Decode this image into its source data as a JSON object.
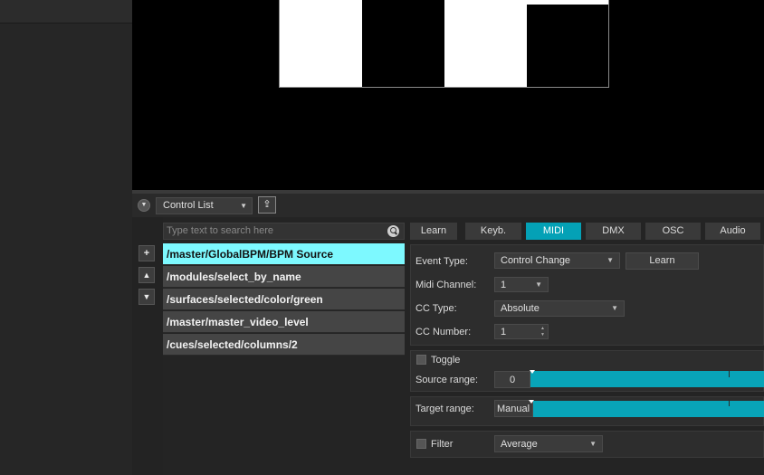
{
  "control_strip": {
    "list_dropdown": "Control List",
    "collapse_glyph": "▼",
    "export_glyph": "⇪"
  },
  "tools": {
    "add": "+",
    "up": "▲",
    "down": "▼"
  },
  "search": {
    "placeholder": "Type text to search here"
  },
  "control_list": [
    {
      "label": "/master/GlobalBPM/BPM Source",
      "selected": true
    },
    {
      "label": "/modules/select_by_name",
      "selected": false
    },
    {
      "label": "/surfaces/selected/color/green",
      "selected": false
    },
    {
      "label": "/master/master_video_level",
      "selected": false
    },
    {
      "label": "/cues/selected/columns/2",
      "selected": false
    }
  ],
  "tabs": [
    {
      "label": "Learn",
      "active": false
    },
    {
      "label": "Keyb.",
      "active": false
    },
    {
      "label": "MIDI",
      "active": true
    },
    {
      "label": "DMX",
      "active": false
    },
    {
      "label": "OSC",
      "active": false
    },
    {
      "label": "Audio",
      "active": false
    }
  ],
  "midi": {
    "event_type_label": "Event Type:",
    "event_type_value": "Control Change",
    "learn_button": "Learn",
    "channel_label": "Midi Channel:",
    "channel_value": "1",
    "cc_type_label": "CC Type:",
    "cc_type_value": "Absolute",
    "cc_number_label": "CC Number:",
    "cc_number_value": "1"
  },
  "mapping": {
    "toggle_label": "Toggle",
    "source_range_label": "Source range:",
    "source_range_value": "0",
    "target_range_label": "Target range:",
    "target_range_value": "Manual",
    "filter_label": "Filter",
    "filter_value": "Average"
  },
  "colors": {
    "accent": "#04a1b6",
    "selected_row": "#7df9ff",
    "range_bar": "#08a4b8"
  }
}
